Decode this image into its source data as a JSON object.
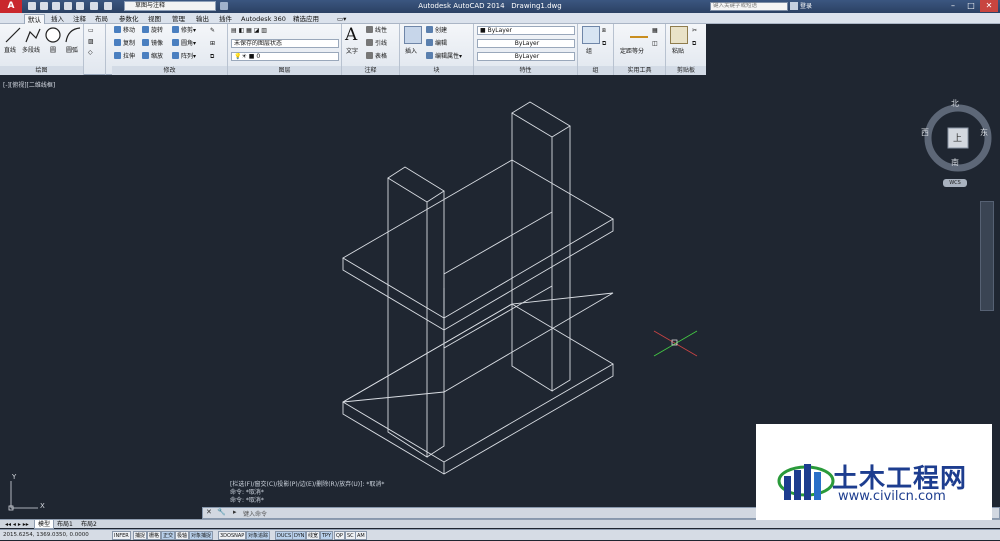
{
  "titlebar": {
    "app_title": "Autodesk AutoCAD 2014",
    "doc_title": "Drawing1.dwg",
    "workspace": "草图与注释",
    "search_placeholder": "键入关键字或短语",
    "login": "登录",
    "app_button": "A"
  },
  "tabs": [
    "默认",
    "插入",
    "注释",
    "布局",
    "参数化",
    "视图",
    "管理",
    "输出",
    "插件",
    "Autodesk 360",
    "精选应用"
  ],
  "ribbon": {
    "draw": {
      "title": "绘图",
      "items": [
        "直线",
        "多段线",
        "圆",
        "圆弧"
      ]
    },
    "modify": {
      "title": "修改",
      "items": [
        "移动",
        "旋转",
        "修剪",
        "复制",
        "镜像",
        "圆角",
        "拉伸",
        "缩放",
        "阵列"
      ]
    },
    "layers": {
      "title": "图层",
      "state": "未保存的图层状态",
      "layer_value": "0"
    },
    "annotation": {
      "title": "注释",
      "big": "文字",
      "items": [
        "线性",
        "引线",
        "表格"
      ]
    },
    "block": {
      "title": "块",
      "big": "插入",
      "items": [
        "创建",
        "编辑",
        "编辑属性"
      ]
    },
    "properties": {
      "title": "特性",
      "values": [
        "ByLayer",
        "ByLayer",
        "ByLayer"
      ]
    },
    "groups": {
      "title": "组",
      "big": "组"
    },
    "utilities": {
      "title": "实用工具",
      "big": "定距等分"
    },
    "clipboard": {
      "title": "剪贴板",
      "big": "粘贴"
    }
  },
  "viewport": {
    "label": "[-][俯视][二维线框]"
  },
  "viewcube": {
    "north": "北",
    "south": "南",
    "east": "东",
    "west": "西",
    "face": "上",
    "wcs": "WCS"
  },
  "command": {
    "options": "[栏选(F)/窗交(C)/投影(P)/边(E)/删除(R)/放弃(U)]: *取消*",
    "line1": "命令: *取消*",
    "line2": "命令: *取消*",
    "prompt": "键入命令"
  },
  "layout_tabs": [
    "模型",
    "布局1",
    "布局2"
  ],
  "status": {
    "coords": "2015.6254, 1369.0350, 0.0000",
    "toggles": [
      "INFER",
      "捕捉",
      "栅格",
      "正交",
      "极轴",
      "对象捕捉",
      "3DOSNAP",
      "对象追踪",
      "DUCS",
      "DYN",
      "线宽",
      "TPY",
      "QP",
      "SC",
      "AM"
    ]
  },
  "watermark": {
    "brand": "土木工程网",
    "url": "www.civilcn.com"
  },
  "colors": {
    "accent": "#1d3d8f",
    "viewport_bg": "#1f2631",
    "line": "#d9dde3",
    "app_red": "#c9272d"
  }
}
